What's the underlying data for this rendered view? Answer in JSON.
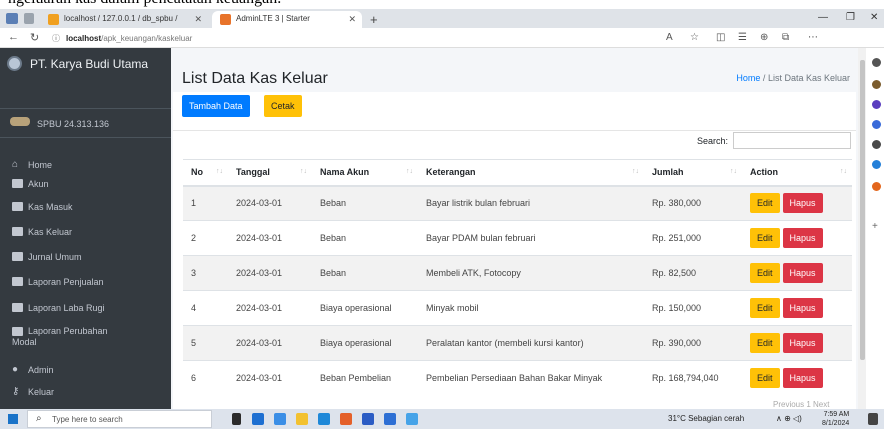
{
  "caption": "ngeluaran kas dalam pencatatan keuangan.",
  "browser": {
    "tabs": [
      {
        "label": "localhost / 127.0.0.1 / db_spbu /"
      },
      {
        "label": "AdminLTE 3 | Starter"
      }
    ],
    "url_host": "localhost",
    "url_path": "/apk_keuangan/kaskeluar"
  },
  "sidebar": {
    "brand": "PT. Karya Budi Utama",
    "user": "SPBU 24.313.136",
    "items": [
      {
        "label": "Home",
        "icon": "home-icon"
      },
      {
        "label": "Akun",
        "icon": "envelope-icon"
      },
      {
        "label": "Kas Masuk",
        "icon": "envelope-icon"
      },
      {
        "label": "Kas Keluar",
        "icon": "envelope-icon"
      },
      {
        "label": "Jurnal Umum",
        "icon": "envelope-icon"
      },
      {
        "label": "Laporan Penjualan",
        "icon": "envelope-icon"
      },
      {
        "label": "Laporan Laba Rugi",
        "icon": "envelope-icon"
      },
      {
        "label": "Laporan Perubahan",
        "label2": "Modal",
        "icon": "envelope-icon"
      },
      {
        "label": "Admin",
        "icon": "user-icon"
      },
      {
        "label": "Keluar",
        "icon": "key-icon"
      }
    ]
  },
  "main": {
    "title": "List Data Kas Keluar",
    "breadcrumb_home": "Home",
    "breadcrumb_sep": "/",
    "breadcrumb_current": "List Data Kas Keluar",
    "add_button": "Tambah Data",
    "print_button": "Cetak",
    "search_label": "Search:",
    "columns": [
      "No",
      "Tanggal",
      "Nama Akun",
      "Keterangan",
      "Jumlah",
      "Action"
    ],
    "rows": [
      {
        "no": "1",
        "tanggal": "2024-03-01",
        "akun": "Beban",
        "keterangan": "Bayar listrik bulan februari",
        "jumlah": "Rp. 380,000"
      },
      {
        "no": "2",
        "tanggal": "2024-03-01",
        "akun": "Beban",
        "keterangan": "Bayar PDAM bulan februari",
        "jumlah": "Rp. 251,000"
      },
      {
        "no": "3",
        "tanggal": "2024-03-01",
        "akun": "Beban",
        "keterangan": "Membeli ATK, Fotocopy",
        "jumlah": "Rp. 82,500"
      },
      {
        "no": "4",
        "tanggal": "2024-03-01",
        "akun": "Biaya operasional",
        "keterangan": "Minyak mobil",
        "jumlah": "Rp. 150,000"
      },
      {
        "no": "5",
        "tanggal": "2024-03-01",
        "akun": "Biaya operasional",
        "keterangan": "Peralatan kantor (membeli kursi kantor)",
        "jumlah": "Rp. 390,000"
      },
      {
        "no": "6",
        "tanggal": "2024-03-01",
        "akun": "Beban Pembelian",
        "keterangan": "Pembelian Persediaan Bahan Bakar Minyak",
        "jumlah": "Rp. 168,794,040"
      }
    ],
    "edit_label": "Edit",
    "delete_label": "Hapus",
    "pager": "Previous   1   Next"
  },
  "taskbar": {
    "search_placeholder": "Type here to search",
    "weather": "31°C  Sebagian cerah",
    "time": "7:59 AM",
    "date": "8/1/2024"
  },
  "colors": {
    "sidebar_bg": "#343a40",
    "primary": "#007bff",
    "warning": "#ffc107",
    "danger": "#dc3545"
  }
}
